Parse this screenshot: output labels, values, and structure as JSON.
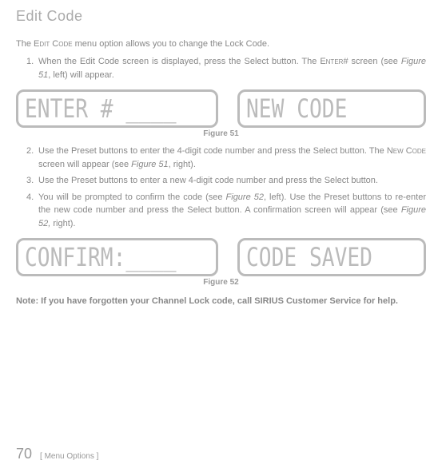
{
  "title": "Edit Code",
  "intro_pre": "The ",
  "intro_sc": "Edit Code",
  "intro_post": " menu option allows you to change the Lock Code.",
  "steps": {
    "s1": {
      "num": "1.",
      "a": "When the Edit Code screen is displayed, press the Select button. The ",
      "sc": "Enter",
      "b": "# screen (see ",
      "fig": "Figure 51",
      "c": ", left) will appear."
    },
    "s2": {
      "num": "2.",
      "a": "Use the Preset buttons to enter the 4-digit code number and press the Select button. The ",
      "sc": "New Code",
      "b": " screen will appear (see ",
      "fig": "Figure 51",
      "c": ", right)."
    },
    "s3": {
      "num": "3.",
      "a": "Use the Preset buttons to enter a new 4-digit code number and press the Select button."
    },
    "s4": {
      "num": "4.",
      "a": "You will be prompted to confirm the code (see ",
      "fig1": "Figure 52",
      "b": ", left). Use the Preset buttons to re-enter the new code number and press the Select button. A confirmation screen will appear (see ",
      "fig2": "Figure 52,",
      "c": " right)."
    }
  },
  "lcd": {
    "enter": "ENTER # ____",
    "newcode": "NEW CODE",
    "confirm": "CONFIRM:____",
    "saved": "CODE SAVED"
  },
  "fig51": "Figure 51",
  "fig52": "Figure 52",
  "note": "Note: If you have forgotten your Channel Lock code, call SIRIUS Customer Service for help.",
  "footer": {
    "page": "70",
    "section": "[ Menu Options ]"
  }
}
